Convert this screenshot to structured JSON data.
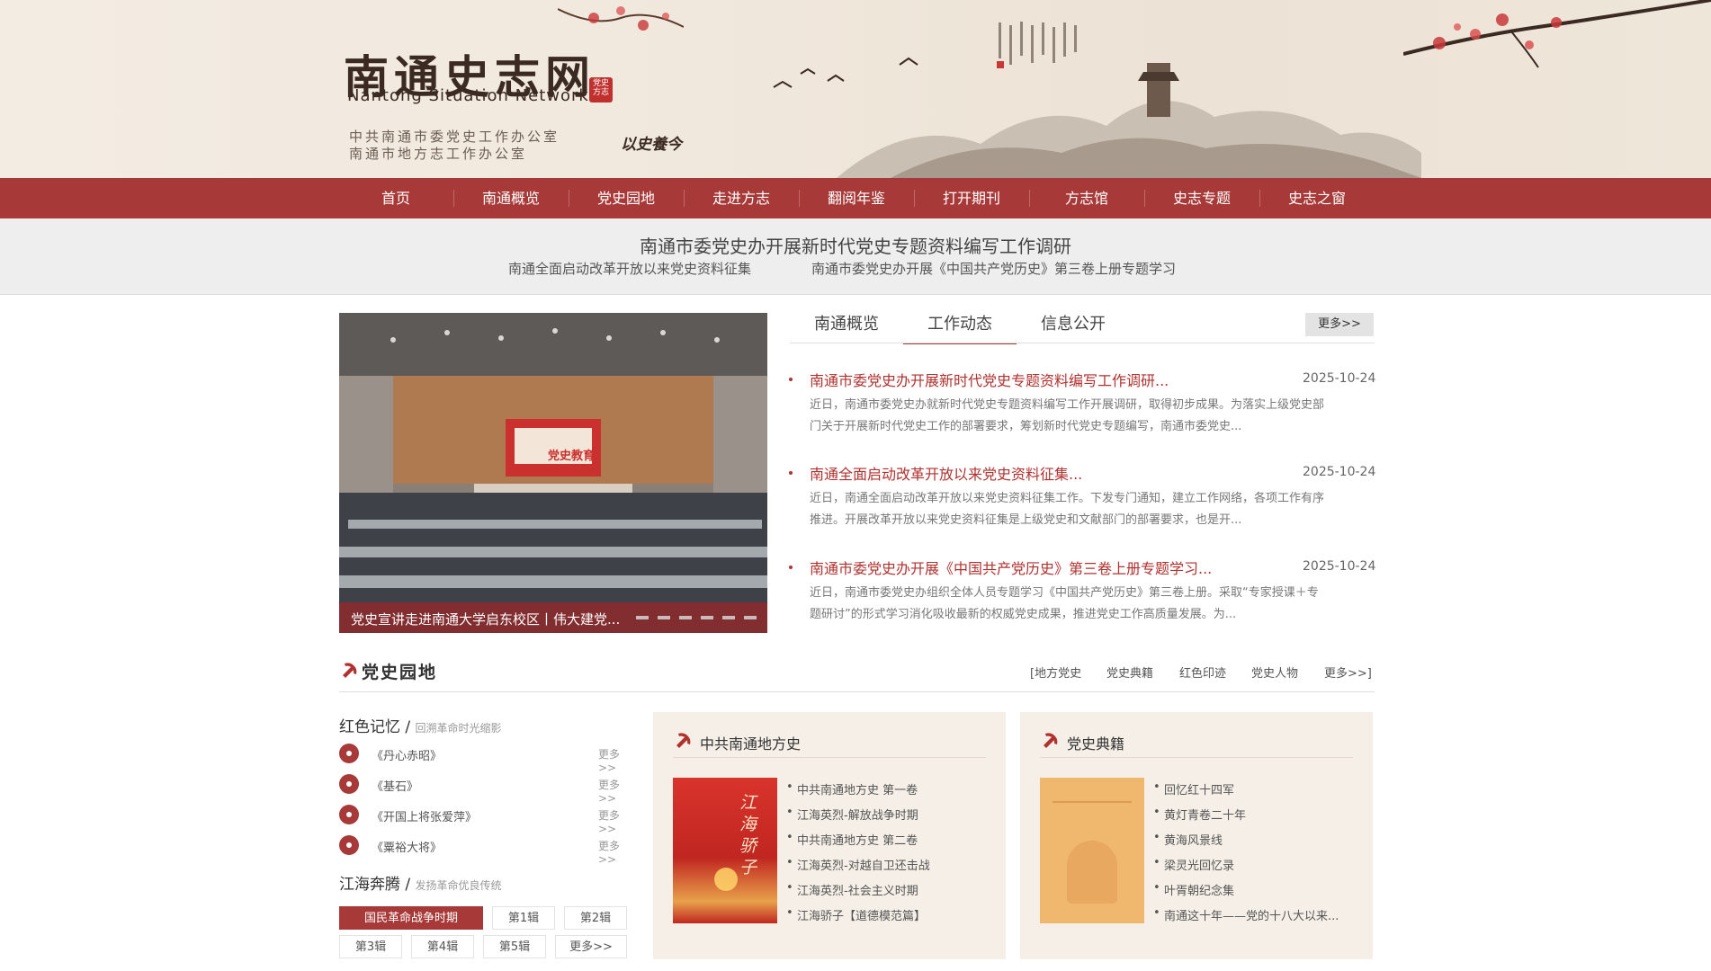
{
  "banner": {
    "logo_cn": "南通史志网",
    "logo_en": "Nantong Situation Network",
    "seal": "党史方志",
    "office_1": "中共南通市委党史工作办公室",
    "office_2": "南通市地方志工作办公室",
    "motto": "以史養今"
  },
  "nav": [
    "首页",
    "南通概览",
    "党史园地",
    "走进方志",
    "翻阅年鉴",
    "打开期刊",
    "方志馆",
    "史志专题",
    "史志之窗"
  ],
  "headline": {
    "main": "南通市委党史办开展新时代党史专题资料编写工作调研",
    "sub_left": "南通全面启动改革开放以来党史资料征集",
    "sub_right": "南通市委党史办开展《中国共产党历史》第三卷上册专题学习"
  },
  "slide": {
    "screen_text": "党史教育",
    "caption": "党史宣讲走进南通大学启东校区丨伟大建党..."
  },
  "tabs": {
    "items": [
      "南通概览",
      "工作动态",
      "信息公开"
    ],
    "active": 1,
    "more": "更多>>"
  },
  "news": [
    {
      "title": "南通市委党史办开展新时代党史专题资料编写工作调研...",
      "date": "2025-10-24",
      "desc1": "近日，南通市委党史办就新时代党史专题资料编写工作开展调研，取得初步成果。为落实上级党史部",
      "desc2": "门关于开展新时代党史工作的部署要求，筹划新时代党史专题编写，南通市委党史..."
    },
    {
      "title": "南通全面启动改革开放以来党史资料征集...",
      "date": "2025-10-24",
      "desc1": "近日，南通全面启动改革开放以来党史资料征集工作。下发专门通知，建立工作网络，各项工作有序",
      "desc2": "推进。开展改革开放以来党史资料征集是上级党史和文献部门的部署要求，也是开..."
    },
    {
      "title": "南通市委党史办开展《中国共产党历史》第三卷上册专题学习...",
      "date": "2025-10-24",
      "desc1": "近日，南通市委党史办组织全体人员专题学习《中国共产党历史》第三卷上册。采取“专家授课＋专",
      "desc2": "题研讨”的形式学习消化吸收最新的权威党史成果，推进党史工作高质量发展。为..."
    }
  ],
  "section": {
    "title": "党史园地",
    "links": [
      "[地方党史",
      "党史典籍",
      "红色印迹",
      "党史人物",
      "更多>>]"
    ]
  },
  "red_memory": {
    "title": "红色记忆",
    "sep": "/",
    "subtitle": "回溯革命时光缩影",
    "items": [
      "《丹心赤昭》",
      "《基石》",
      "《开国上将张爱萍》",
      "《粟裕大将》"
    ],
    "more": "更多>>"
  },
  "jianghai": {
    "title": "江海奔腾",
    "sep": "/",
    "subtitle": "发扬革命优良传统",
    "pills": [
      "国民革命战争时期",
      "第1辑",
      "第2辑",
      "第3辑",
      "第4辑",
      "第5辑",
      "更多>>"
    ]
  },
  "panel_local": {
    "title": "中共南通地方史",
    "cover_text": "江海骄子",
    "items": [
      "中共南通地方史 第一卷",
      "江海英烈-解放战争时期",
      "中共南通地方史 第二卷",
      "江海英烈-对越自卫还击战",
      "江海英烈-社会主义时期",
      "江海骄子【道德模范篇】"
    ]
  },
  "panel_books": {
    "title": "党史典籍",
    "items": [
      "回忆红十四军",
      "黄灯青卷二十年",
      "黄海风景线",
      "梁灵光回忆录",
      "叶胥朝纪念集",
      "南通这十年——党的十八大以来..."
    ]
  },
  "colors": {
    "brand_red": "#a73a38",
    "link_red": "#b0322f",
    "panel_bg": "#f5efe7"
  }
}
